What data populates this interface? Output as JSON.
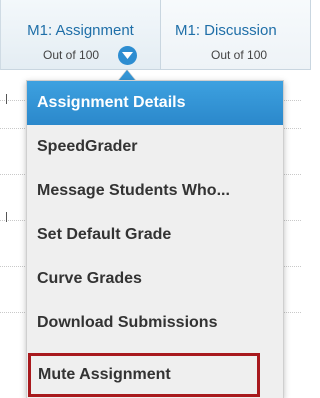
{
  "header": {
    "columns": [
      {
        "title": "M1: Assignment",
        "subtitle": "Out of 100"
      },
      {
        "title": "M1: Discussion",
        "subtitle": "Out of 100"
      }
    ],
    "menu_toggle_icon": "chevron-down-icon"
  },
  "menu": {
    "items": [
      {
        "label": "Assignment Details",
        "state": "highlighted"
      },
      {
        "label": "SpeedGrader"
      },
      {
        "label": "Message Students Who..."
      },
      {
        "label": "Set Default Grade"
      },
      {
        "label": "Curve Grades"
      },
      {
        "label": "Download Submissions"
      },
      {
        "label": "Mute Assignment",
        "state": "outlined"
      }
    ]
  },
  "colors": {
    "accent": "#2d8dd1",
    "highlight": "#3596d6",
    "outline": "#a8191d",
    "header_text": "#1f6fa8"
  }
}
